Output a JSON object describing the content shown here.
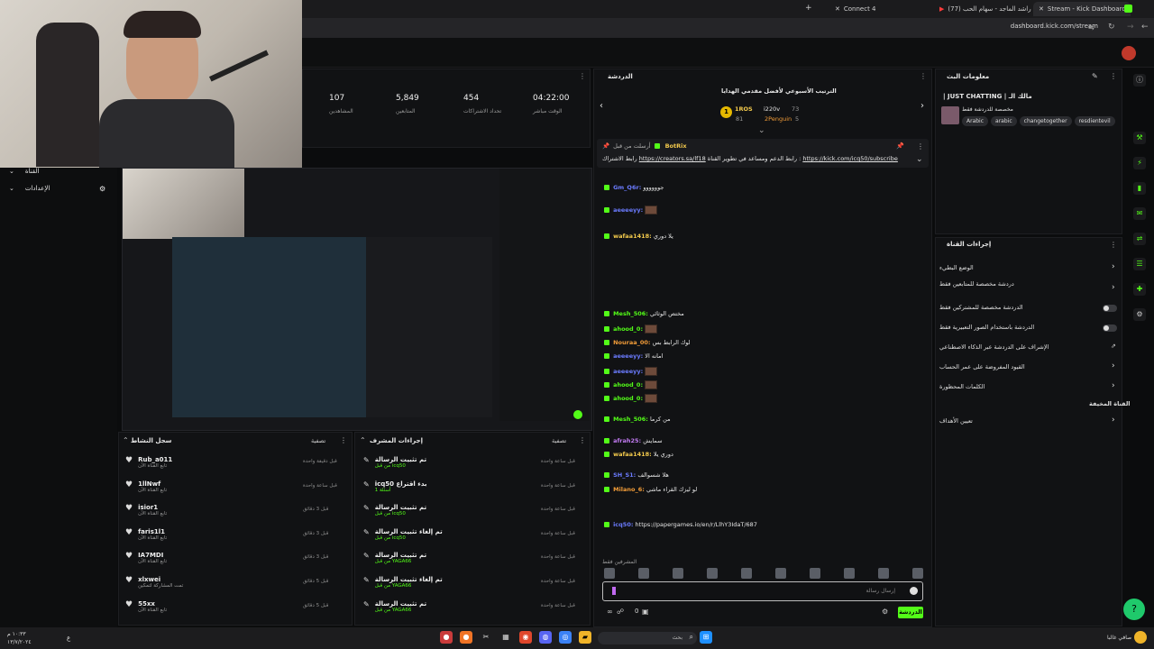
{
  "browser": {
    "tabs": [
      {
        "label": "Connect 4"
      },
      {
        "label": "راشد الماجد - سهام الحب (77)"
      },
      {
        "label": "Stream - Kick Dashboard"
      }
    ],
    "url": "dashboard.kick.com/stream"
  },
  "stats": [
    {
      "value": "107",
      "label": "المشاهدين"
    },
    {
      "value": "5,849",
      "label": "المتابعين"
    },
    {
      "value": "454",
      "label": "تحداد الاشتراكات"
    },
    {
      "value": "04:22:00",
      "label": "الوقت مباشر"
    }
  ],
  "left_sidebar": {
    "item1": "القناة",
    "item2": "الإعدادات"
  },
  "chat": {
    "title": "الدردشة",
    "contest_title": "الترتيب الأسبوعي لأفضل مقدمي الهدايا",
    "leader1_name": "1ROS",
    "leader1_pts": "73",
    "leader1_rank": "1",
    "leader2_name": "i220v",
    "leader2_pts": "81",
    "leader3_name": "2Penguin",
    "leader3_pts": "5",
    "pinned_user": "BotRix",
    "pinned_prefix": "أرسلت من قبل",
    "pinned_text": "رابط الاشتراك",
    "pinned_link1": "https://creators.sa/lf18",
    "pinned_mid": "رابط الدعم ومساعد في تطوير القناة :",
    "pinned_link2": "https://kick.com/icq50/subscribe",
    "input_placeholder": "إرسال رسالة",
    "send_label": "الدردشة",
    "viewer_count": "0",
    "typing_label": "المشرفين فقط"
  },
  "chat_lines": [
    {
      "user": "Gm_Q6r:",
      "text": "جوووووو"
    },
    {
      "user": "aeeeeyy:",
      "text": ""
    },
    {
      "user": "wafaa1418:",
      "text": "يلا دوري"
    },
    {
      "user": "Mesh_506:",
      "text": "مختص الوثائي"
    },
    {
      "user": "ahood_0:",
      "text": ""
    },
    {
      "user": "Nouraa_00:",
      "text": "لوك الرابط بس"
    },
    {
      "user": "aeeeeyy:",
      "text": "امانه الا"
    },
    {
      "user": "aeeeeyy:",
      "text": ""
    },
    {
      "user": "ahood_0:",
      "text": ""
    },
    {
      "user": "ahood_0:",
      "text": ""
    },
    {
      "user": "Mesh_506:",
      "text": "من كرما"
    },
    {
      "user": "afrah25:",
      "text": "سمايش"
    },
    {
      "user": "wafaa1418:",
      "text": "دوري يلا"
    },
    {
      "user": "SH_S1:",
      "text": "هلا شسوالف"
    },
    {
      "user": "Milano_6:",
      "text": "لو ليزك القراء ماشي"
    },
    {
      "user": "icq50:",
      "text": "https://papergames.io/en/r/LlhY3IdaT/687"
    }
  ],
  "channel_info": {
    "title": "معلومات البث",
    "stream_title": "| JUST CHATTING | مالك الـ",
    "category": "مخصصة للدردشة فقط",
    "tags": [
      "Arabic",
      "arabic",
      "changetogether",
      "resdientevil"
    ]
  },
  "channel_actions": {
    "title": "إجراءات القناة",
    "items": [
      {
        "label": "الوضع البطيء"
      },
      {
        "label": "دردشة مخصصة للمتابعين فقط"
      },
      {
        "label": "الدردشة مخصصة للمشتركين فقط"
      },
      {
        "label": "الدردشة باستخدام الصور التعبيرية فقط"
      },
      {
        "label": "الإشراف على الدردشة عبر الذكاء الاصطناعي"
      },
      {
        "label": "القيود المفروضة على عمر الحساب"
      },
      {
        "label": "الكلمات المحظورة"
      },
      {
        "label": "القناة المخيفة"
      },
      {
        "label": "تعيين الأهداف"
      }
    ]
  },
  "activity": {
    "title": "سجل النشاط",
    "filter": "تصفية",
    "rows": [
      {
        "name": "Rub_a011",
        "sub": "تابع القناة الآن",
        "time": "قبل دقيقة واحدة"
      },
      {
        "name": "1llNwf",
        "sub": "تابع القناة الآن",
        "time": "قبل ساعة واحدة"
      },
      {
        "name": "isior1",
        "sub": "تابع القناة الآن",
        "time": "قبل 3 دقائق"
      },
      {
        "name": "faris1l1",
        "sub": "تابع القناة الآن",
        "time": "قبل 3 دقائق"
      },
      {
        "name": "IA7MDI",
        "sub": "تابع القناة الآن",
        "time": "قبل 3 دقائق"
      },
      {
        "name": "xlxwei",
        "sub": "تمت المشاركة لتمكين",
        "time": "قبل 5 دقائق"
      },
      {
        "name": "55xx",
        "sub": "تابع القناة الآن",
        "time": "قبل 5 دقائق"
      }
    ]
  },
  "mod_actions": {
    "title": "إجراءات المشرف",
    "filter": "تصفية",
    "rows": [
      {
        "name": "تم تثبيت الرسالة",
        "sub": "من قبل icq50",
        "time": "قبل ساعة واحدة"
      },
      {
        "name": "icq50 بدء اقتراع",
        "sub": "أسئلة 1",
        "time": "قبل ساعة واحدة"
      },
      {
        "name": "تم تثبيت الرسالة",
        "sub": "من قبل icq50",
        "time": "قبل ساعة واحدة"
      },
      {
        "name": "تم إلغاء تثبيت الرسالة",
        "sub": "من قبل icq50",
        "time": "قبل ساعة واحدة"
      },
      {
        "name": "تم تثبيت الرسالة",
        "sub": "من قبل YAGA66",
        "time": "قبل ساعة واحدة"
      },
      {
        "name": "تم إلغاء تثبيت الرسالة",
        "sub": "من قبل YAGA66",
        "time": "قبل ساعة واحدة"
      },
      {
        "name": "تم تثبيت الرسالة",
        "sub": "من قبل YAGA66",
        "time": "قبل ساعة واحدة"
      }
    ]
  },
  "taskbar": {
    "search_placeholder": "بحث",
    "clock_time": "١٠:٣٣ م",
    "clock_date": "١٣/٧/٢٠٢٤",
    "weather": "صافي غالبا",
    "lang": "ع"
  },
  "colors": {
    "accent": "#53fc18",
    "bg": "#0b0c0d",
    "panel": "#111214"
  }
}
